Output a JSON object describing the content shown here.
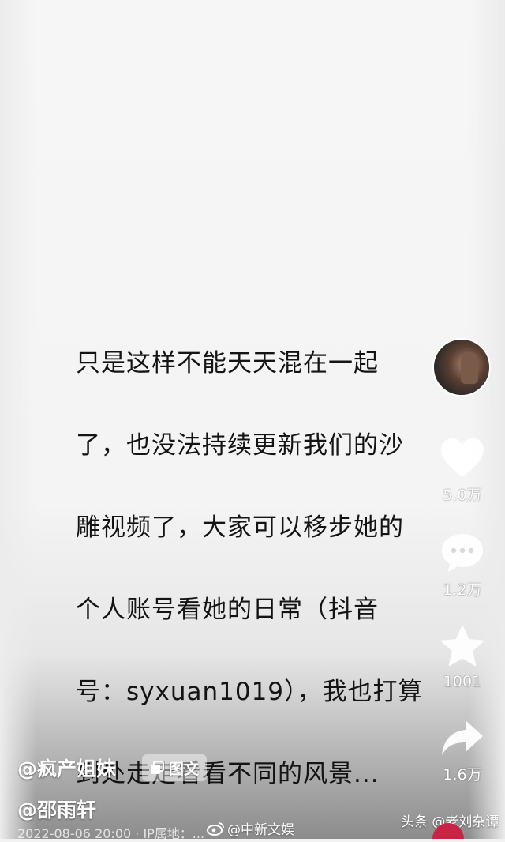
{
  "post": {
    "text_lines": [
      "只是这样不能天天混在一起",
      "了，也没法持续更新我们的沙",
      "雕视频了，大家可以移步她的",
      "个人账号看她的日常（抖音",
      "号：syxuan1019），我也打算",
      "到处走走看看不同的风景..."
    ],
    "author": "@疯产姐妹",
    "type_badge": "图文",
    "mention": "@邵雨轩",
    "meta": "2022-08-06 20:00 · IP属地：..."
  },
  "actions": {
    "like_count": "5.0万",
    "comment_count": "1.2万",
    "favorite_count": "1001",
    "share_count": "1.6万"
  },
  "watermarks": {
    "weibo": "@中新文娱",
    "toutiao": "头条 @老刘杂谭"
  },
  "colors": {
    "icon_fill": "#ffffff",
    "text_dark": "#141414"
  }
}
